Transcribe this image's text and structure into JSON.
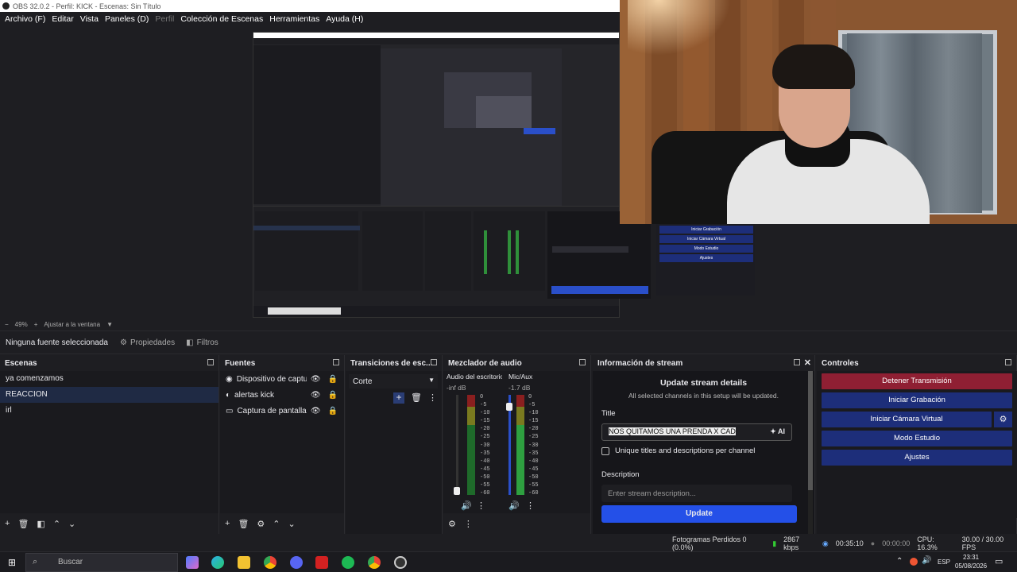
{
  "window": {
    "title": "OBS 32.0.2 - Perfil: KICK - Escenas: Sin Título"
  },
  "menu": [
    {
      "label": "Archivo (F)",
      "dim": false
    },
    {
      "label": "Editar",
      "dim": false
    },
    {
      "label": "Vista",
      "dim": false
    },
    {
      "label": "Paneles (D)",
      "dim": false
    },
    {
      "label": "Perfil",
      "dim": true
    },
    {
      "label": "Colección de Escenas",
      "dim": false
    },
    {
      "label": "Herramientas",
      "dim": false
    },
    {
      "label": "Ayuda (H)",
      "dim": false
    }
  ],
  "preview": {
    "mini_controls": [
      "Iniciar Grabación",
      "Iniciar Cámara Virtual",
      "Modo Estudio",
      "Ajustes"
    ]
  },
  "zoom": {
    "minus": "−",
    "value": "49%",
    "plus": "+",
    "fit": "Ajustar a la ventana"
  },
  "context": {
    "no_source": "Ninguna fuente seleccionada",
    "properties": "Propiedades",
    "filters": "Filtros"
  },
  "scenes": {
    "title": "Escenas",
    "items": [
      "ya comenzamos",
      "REACCION",
      "irl"
    ],
    "selected": 1
  },
  "sources": {
    "title": "Fuentes",
    "items": [
      {
        "icon": "monitor-capture-icon",
        "name": "Dispositivo de captura de vídeo"
      },
      {
        "icon": "browser-source-icon",
        "name": "alertas kick"
      },
      {
        "icon": "display-capture-icon",
        "name": "Captura de pantalla"
      }
    ]
  },
  "transitions": {
    "title": "Transiciones de esc...",
    "current": "Corte"
  },
  "mixer": {
    "title": "Mezclador de audio",
    "ch1": {
      "name": "Audio del escritorio",
      "db": "-inf dB"
    },
    "ch2": {
      "name": "Mic/Aux",
      "db": "-1.7 dB"
    },
    "scale": [
      "0",
      "-5",
      "-10",
      "-15",
      "-20",
      "-25",
      "-30",
      "-35",
      "-40",
      "-45",
      "-50",
      "-55",
      "-60"
    ]
  },
  "stream": {
    "title": "Información de stream",
    "heading": "Update stream details",
    "sub": "All selected channels in this setup will be updated.",
    "title_label": "Title",
    "title_value": "NOS QUITAMOS UNA PRENDA X CADA SE",
    "ai": "AI",
    "unique": "Unique titles and descriptions per channel",
    "desc_label": "Description",
    "desc_placeholder": "Enter stream description...",
    "update": "Update"
  },
  "controls": {
    "title": "Controles",
    "stop": "Detener Transmisión",
    "record": "Iniciar Grabación",
    "virtualcam": "Iniciar Cámara Virtual",
    "studio": "Modo Estudio",
    "settings": "Ajustes"
  },
  "status": {
    "dropped": "Fotogramas Perdidos 0 (0.0%)",
    "kbps": "2867 kbps",
    "stream_time": "00:35:10",
    "rec_time": "00:00:00",
    "cpu": "CPU: 16.3%",
    "fps": "30.00 / 30.00 FPS"
  },
  "taskbar": {
    "search": "Buscar",
    "lang": "ESP",
    "time": "23:31",
    "date": "05/08/2026"
  },
  "colors": {
    "stop": "#8f1f33",
    "blue_btn": "#1d2e7a",
    "update": "#2450e8"
  }
}
